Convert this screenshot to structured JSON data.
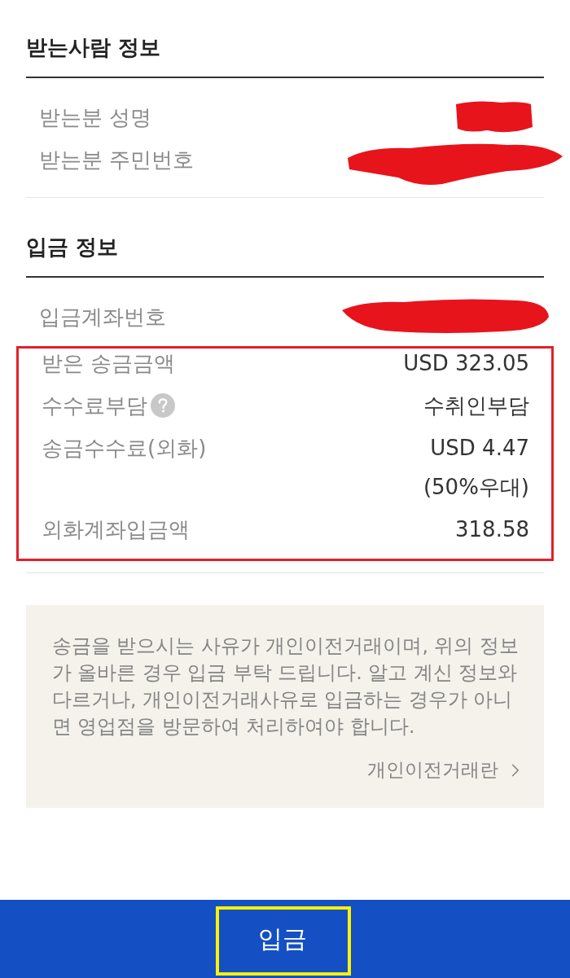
{
  "sections": [
    {
      "title": "받는사람 정보",
      "groups": [
        {
          "rows": [
            {
              "label": "받는분 성명",
              "redacted": true
            },
            {
              "label": "받는분 주민번호",
              "redacted": true
            }
          ]
        }
      ]
    },
    {
      "title": "입금 정보",
      "groups": [
        {
          "rows": [
            {
              "label": "입금계좌번호",
              "redacted": true
            }
          ]
        },
        {
          "highlighted": true,
          "rows": [
            {
              "label": "받은 송금금액",
              "value": "USD 323.05"
            },
            {
              "label": "수수료부담",
              "help": true,
              "value": "수취인부담"
            },
            {
              "label": "송금수수료(외화)",
              "value": "USD 4.47",
              "note": "(50%우대)"
            },
            {
              "label": "외화계좌입금액",
              "value": "318.58"
            }
          ]
        }
      ]
    }
  ],
  "notice": {
    "text": "송금을 받으시는 사유가 개인이전거래이며, 위의 정보가 올바른 경우 입금 부탁 드립니다. 알고 계신 정보와 다르거나, 개인이전거래사유로 입금하는 경우가 아니면 영업점을 방문하여 처리하여야 합니다.",
    "link": "개인이전거래란"
  },
  "action_button": {
    "label": "입금",
    "highlighted": true
  }
}
